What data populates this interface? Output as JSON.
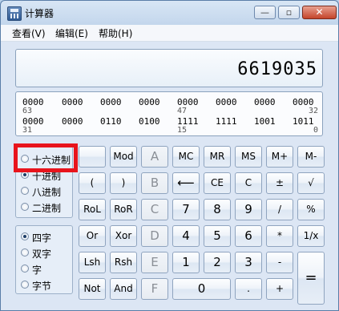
{
  "window": {
    "title": "计算器",
    "min_glyph": "—",
    "max_glyph": "▫",
    "close_glyph": "✕"
  },
  "menu": {
    "view": "查看(V)",
    "edit": "编辑(E)",
    "help": "帮助(H)"
  },
  "display": {
    "value": "6619035"
  },
  "bits": {
    "row1": [
      "0000",
      "0000",
      "0000",
      "0000",
      "0000",
      "0000",
      "0000",
      "0000"
    ],
    "row1_idx": [
      "63",
      "47",
      "32"
    ],
    "row2": [
      "0000",
      "0000",
      "0110",
      "0100",
      "1111",
      "1111",
      "1001",
      "1011"
    ],
    "row2_idx": [
      "31",
      "15",
      "0"
    ]
  },
  "base": {
    "hex": "十六进制",
    "dec": "十进制",
    "oct": "八进制",
    "bin": "二进制",
    "selected": "dec"
  },
  "word": {
    "qword": "四字",
    "dword": "双字",
    "word": "字",
    "byte": "字节",
    "selected": "qword"
  },
  "keys": {
    "blank": "",
    "mod": "Mod",
    "A": "A",
    "MC": "MC",
    "MR": "MR",
    "MS": "MS",
    "Mplus": "M+",
    "Mminus": "M-",
    "lparen": "(",
    "rparen": ")",
    "B": "B",
    "back": "⟵",
    "CE": "CE",
    "C": "C",
    "plusminus": "±",
    "sqrt": "√",
    "RoL": "RoL",
    "RoR": "RoR",
    "Ckey": "C",
    "seven": "7",
    "eight": "8",
    "nine": "9",
    "div": "/",
    "pct": "%",
    "Or": "Or",
    "Xor": "Xor",
    "D": "D",
    "four": "4",
    "five": "5",
    "six": "6",
    "mul": "*",
    "recip": "1/x",
    "Lsh": "Lsh",
    "Rsh": "Rsh",
    "E": "E",
    "one": "1",
    "two": "2",
    "three": "3",
    "minus": "-",
    "eq": "=",
    "Not": "Not",
    "And": "And",
    "F": "F",
    "zero": "0",
    "dot": ".",
    "plus": "+"
  }
}
